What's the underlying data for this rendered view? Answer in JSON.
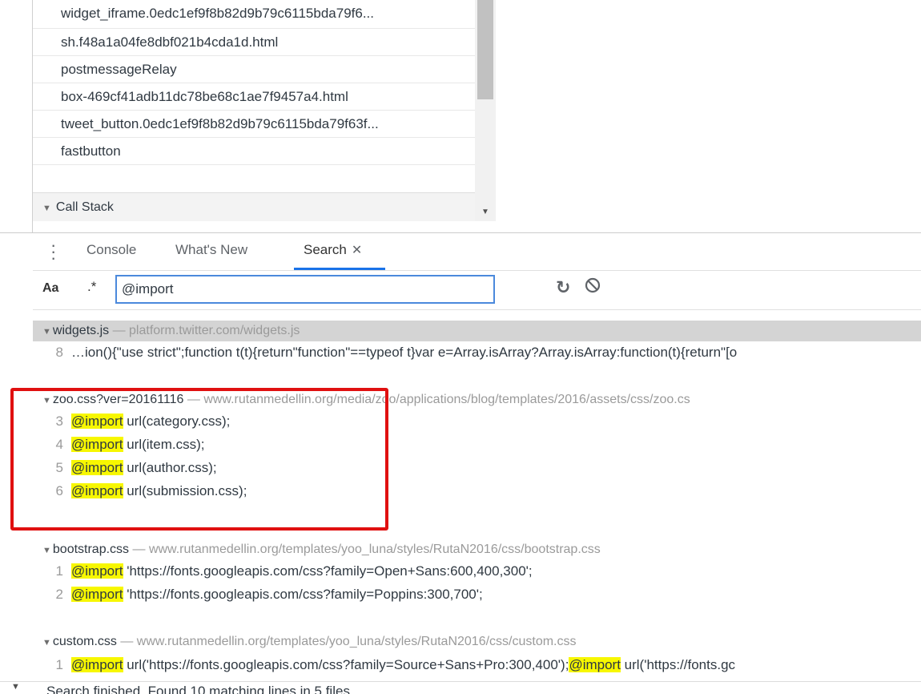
{
  "frames": [
    "widget_iframe.0edc1ef9f8b82d9b79c6115bda79f6...",
    "sh.f48a1a04fe8dbf021b4cda1d.html",
    "postmessageRelay",
    "box-469cf41adb11dc78be68c1ae7f9457a4.html",
    "tweet_button.0edc1ef9f8b82d9b79c6115bda79f63f...",
    "fastbutton"
  ],
  "call_stack_label": "Call Stack",
  "drawer_tabs": {
    "console": "Console",
    "whats_new": "What's New",
    "search": "Search"
  },
  "search": {
    "case_label": "Aa",
    "regex_label": ".*",
    "query": "@import"
  },
  "results": [
    {
      "file": "widgets.js",
      "sep": " — ",
      "path": "platform.twitter.com/widgets.js",
      "lines": [
        {
          "num": "8",
          "pre": "…ion(){\"use strict\";function t(t){return\"function\"==typeof t}var e=Array.isArray?Array.isArray:function(t){return\"[o",
          "match": "",
          "post": ""
        }
      ]
    },
    {
      "file": "zoo.css?ver=20161116",
      "sep": " — ",
      "path": "www.rutanmedellin.org/media/zoo/applications/blog/templates/2016/assets/css/zoo.cs",
      "lines": [
        {
          "num": "3",
          "match": "@import",
          "post": " url(category.css);"
        },
        {
          "num": "4",
          "match": "@import",
          "post": " url(item.css);"
        },
        {
          "num": "5",
          "match": "@import",
          "post": " url(author.css);"
        },
        {
          "num": "6",
          "match": "@import",
          "post": " url(submission.css);"
        }
      ]
    },
    {
      "file": "bootstrap.css",
      "sep": " — ",
      "path": "www.rutanmedellin.org/templates/yoo_luna/styles/RutaN2016/css/bootstrap.css",
      "lines": [
        {
          "num": "1",
          "match": "@import",
          "post": " 'https://fonts.googleapis.com/css?family=Open+Sans:600,400,300';"
        },
        {
          "num": "2",
          "match": "@import",
          "post": " 'https://fonts.googleapis.com/css?family=Poppins:300,700';"
        }
      ]
    },
    {
      "file": "custom.css",
      "sep": " — ",
      "path": "www.rutanmedellin.org/templates/yoo_luna/styles/RutaN2016/css/custom.css",
      "lines": [
        {
          "num": "1",
          "match": "@import",
          "post": " url('https://fonts.googleapis.com/css?family=Source+Sans+Pro:300,400');",
          "match2": "@import",
          "post2": " url('https://fonts.gc"
        }
      ]
    }
  ],
  "status": "Search finished. Found 10 matching lines in 5 files.",
  "colors": {
    "match_highlight": "#f7f700",
    "annotation_box": "#e01010",
    "active_tab": "#1a73e8"
  }
}
